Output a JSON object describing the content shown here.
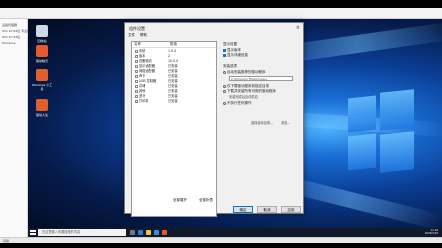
{
  "host": {
    "left_lines": [
      "设备管理器",
      "Win 10 64位 专业版",
      "Win 10 64位",
      "Windows"
    ],
    "status_text": "就绪"
  },
  "desktop": {
    "icons": [
      {
        "label": "回收站",
        "color": "#cfd8e6"
      },
      {
        "label": "驱动精灵",
        "color": "#e55b2c"
      },
      {
        "label": "Windows 小工具",
        "color": "#e0602b"
      },
      {
        "label": "驱动人生",
        "color": "#e0602b"
      }
    ]
  },
  "dialog": {
    "title": "组件设置",
    "close": "×",
    "menu": [
      "文件",
      "帮助"
    ],
    "tree": {
      "headers": [
        "名称",
        "数值"
      ],
      "rows": [
        {
          "name": "系统",
          "value": "1.0.0"
        },
        {
          "name": "版本",
          "value": "2"
        },
        {
          "name": "设备驱动",
          "value": "10.0.0"
        },
        {
          "name": "显示适配器",
          "value": "已安装"
        },
        {
          "name": "网络适配器",
          "value": "已安装"
        },
        {
          "name": "声卡",
          "value": "已安装"
        },
        {
          "name": "USB 控制器",
          "value": "已安装"
        },
        {
          "name": "存储",
          "value": "已安装"
        },
        {
          "name": "其他",
          "value": "已安装"
        },
        {
          "name": "蓝牙",
          "value": "已安装"
        },
        {
          "name": "打印机",
          "value": "已安装"
        }
      ]
    },
    "right": {
      "group1_title": "显示设置",
      "check1": "显示版本",
      "check2": "显示详细信息",
      "group2_title": "安装选项",
      "radio1": "自动安装推荐的驱动程序",
      "radio1_path": "C:\\Program Files\\Drivers",
      "radio2": "仅下载驱动程序到指定目录",
      "radio3": "下载并安装所有可用的驱动程序",
      "radio3_sub": "安装完成后自动重启",
      "radio4": "不执行任何操作",
      "link_left": "选择目标目录...",
      "link_right": "浏览..."
    },
    "tree_buttons": {
      "expand": "全部展开",
      "collapse": "全部折叠"
    },
    "buttons": {
      "ok": "确定",
      "cancel": "取消",
      "apply": "应用"
    }
  },
  "taskbar": {
    "search_placeholder": "在这里输入你要搜索的内容",
    "time": "11:04",
    "date": "2020/3/18"
  }
}
